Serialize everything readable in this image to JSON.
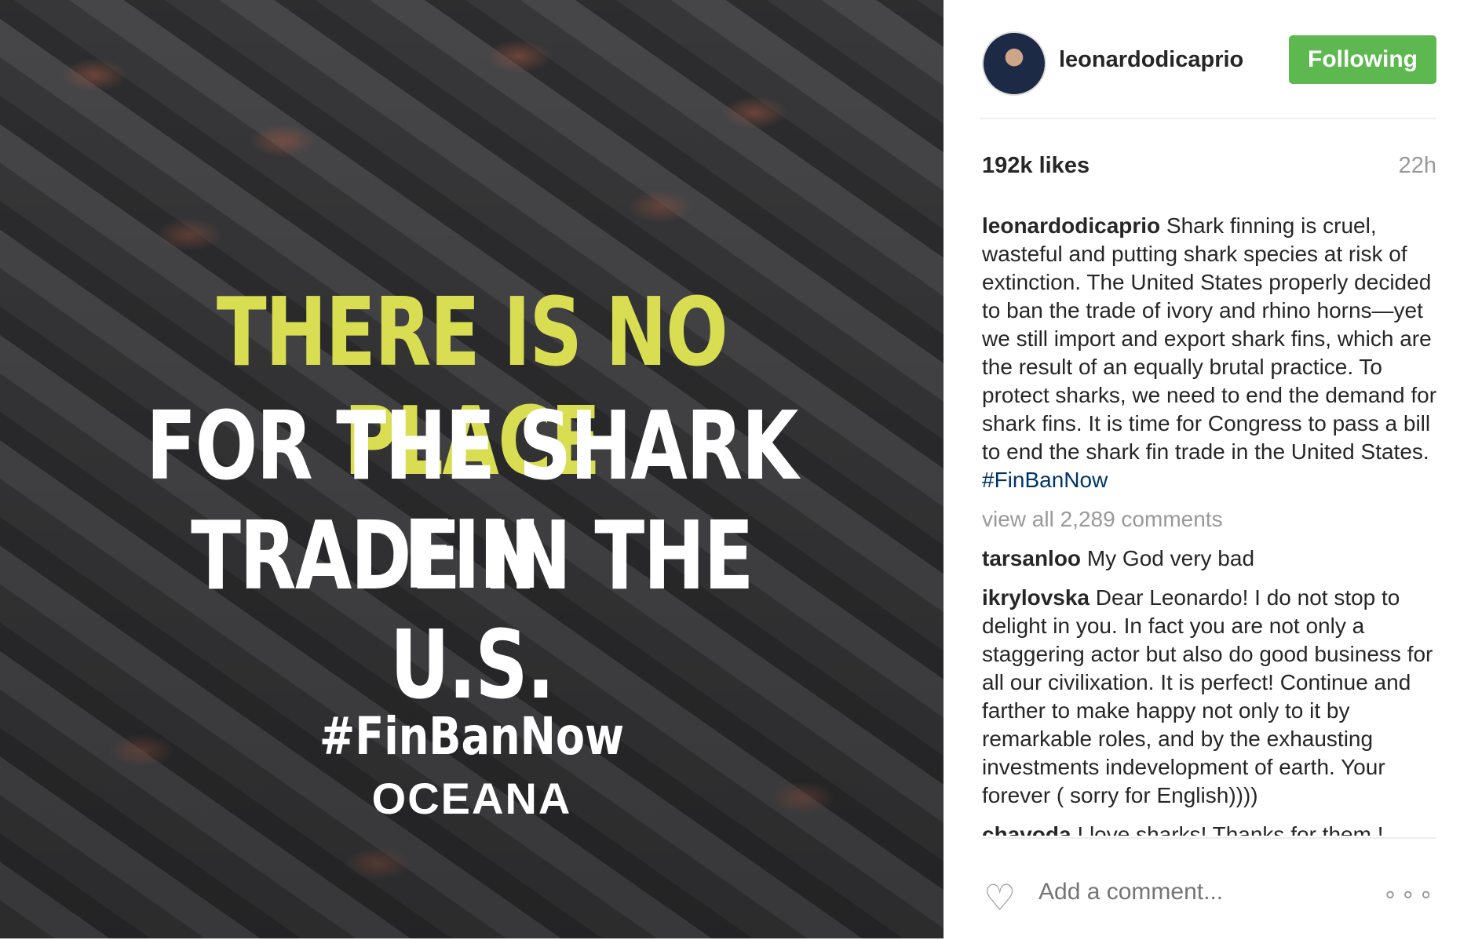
{
  "image": {
    "headline_1": "THERE IS NO PLACE",
    "headline_2": "FOR THE SHARK FIN",
    "headline_3": "TRADE IN THE U.S.",
    "hashtag": "#FinBanNow",
    "brand": "OCEANA",
    "headline_color": "#d9dd52"
  },
  "header": {
    "username": "leonardodicaprio",
    "follow_label": "Following",
    "follow_color": "#5cb84f"
  },
  "meta": {
    "likes": "192k likes",
    "time": "22h"
  },
  "caption": {
    "user": "leonardodicaprio",
    "text": "Shark finning is cruel, wasteful and putting shark species at risk of extinction. The United States properly decided to ban the trade of ivory and rhino horns—yet we still import and export shark fins, which are the result of an equally brutal practice. To protect sharks, we need to end the demand for shark fins. It is time for Congress to pass a bill to end the shark fin trade in the United States.",
    "hashtag": "#FinBanNow"
  },
  "view_all": "view all 2,289 comments",
  "comments": [
    {
      "user": "tarsanloo",
      "text": "My God very bad"
    },
    {
      "user": "ikrylovska",
      "text": "Dear Leonardo! I do not stop to delight in you. In fact you are not only a staggering actor but also do good business for all our civilixation. It is perfect! Continue and farther to make happy not only to it by remarkable roles, and by the exhausting investments indevelopment of earth. Your forever ( sorry for English))))"
    },
    {
      "user": "chavoda",
      "text": "I love sharks! Thanks for them !"
    }
  ],
  "footer": {
    "heart_icon": "heart-icon",
    "placeholder": "Add a comment...",
    "more": "∘∘∘"
  }
}
